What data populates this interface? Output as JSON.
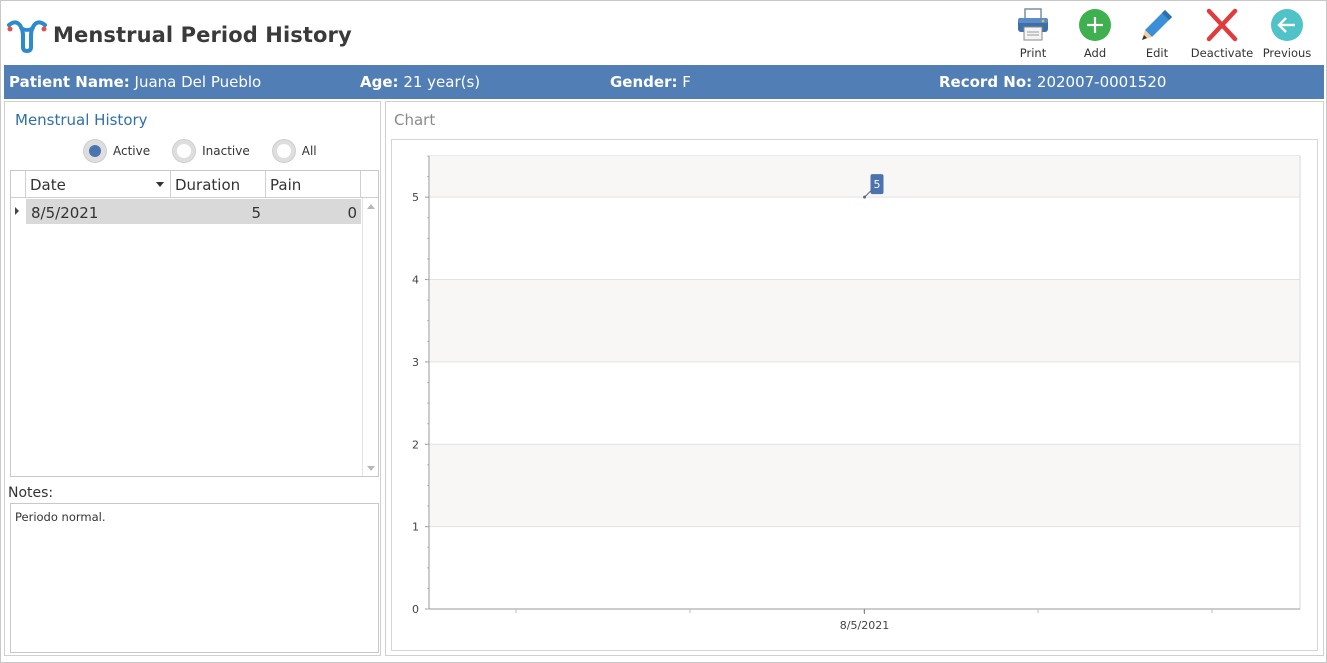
{
  "header": {
    "title": "Menstrual Period History",
    "logo_icon": "uterus-icon",
    "toolbar": [
      {
        "id": "print",
        "label": "Print",
        "icon": "printer-icon"
      },
      {
        "id": "add",
        "label": "Add",
        "icon": "plus-icon"
      },
      {
        "id": "edit",
        "label": "Edit",
        "icon": "pencil-icon"
      },
      {
        "id": "deactivate",
        "label": "Deactivate",
        "icon": "x-icon"
      },
      {
        "id": "previous",
        "label": "Previous",
        "icon": "arrow-left-icon"
      }
    ]
  },
  "patient": {
    "name_label": "Patient Name:",
    "name": "Juana Del Pueblo",
    "age_label": "Age:",
    "age": "21 year(s)",
    "gender_label": "Gender:",
    "gender": "F",
    "record_label": "Record No:",
    "record": "202007-0001520"
  },
  "history": {
    "title": "Menstrual History",
    "filters": [
      {
        "label": "Active",
        "checked": true
      },
      {
        "label": "Inactive",
        "checked": false
      },
      {
        "label": "All",
        "checked": false
      }
    ],
    "columns": [
      "Date",
      "Duration",
      "Pain"
    ],
    "rows": [
      {
        "date": "8/5/2021",
        "duration": "5",
        "pain": "0"
      }
    ]
  },
  "notes": {
    "label": "Notes:",
    "text": "Periodo normal."
  },
  "chart": {
    "title": "Chart"
  },
  "chart_data": {
    "type": "line",
    "categories": [
      "8/5/2021"
    ],
    "values": [
      5
    ],
    "data_labels": [
      "5"
    ],
    "ylim": [
      0,
      5.5
    ],
    "yticks": [
      "0",
      "1",
      "2",
      "3",
      "4",
      "5"
    ],
    "grid": true,
    "accent_color": "#4a73b0"
  },
  "colors": {
    "patient_bar": "#517fb5",
    "section_title": "#2f6fab",
    "row_selected": "#d9d9d9"
  }
}
